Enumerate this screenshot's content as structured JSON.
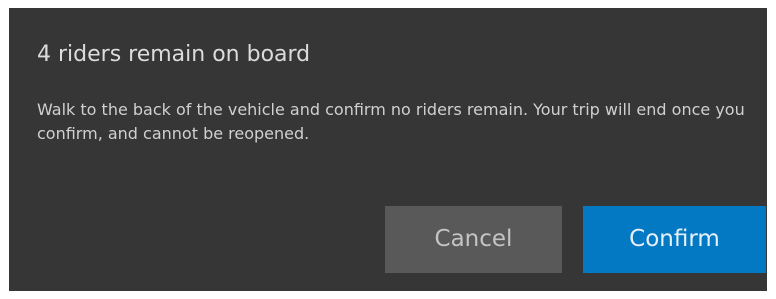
{
  "dialog": {
    "title": "4 riders remain on board",
    "message": "Walk to the back of the vehicle and confirm no riders remain. Your trip will end once you confirm, and cannot be reopened.",
    "cancel_label": "Cancel",
    "confirm_label": "Confirm"
  },
  "colors": {
    "dialog_background": "#363636",
    "cancel_button": "#595959",
    "confirm_button": "#0479c3"
  }
}
